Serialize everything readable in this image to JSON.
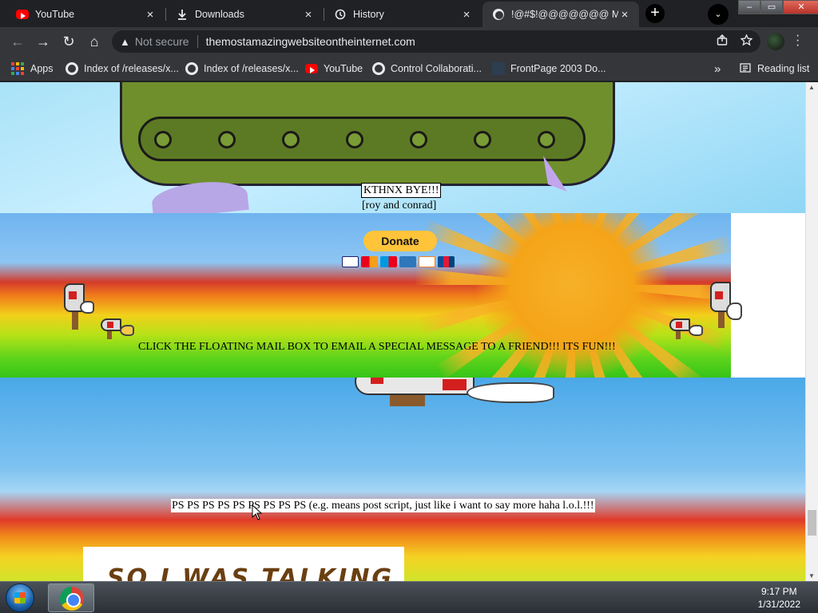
{
  "browser": {
    "tabs": [
      {
        "label": "YouTube",
        "icon": "youtube-icon"
      },
      {
        "label": "Downloads",
        "icon": "download-icon"
      },
      {
        "label": "History",
        "icon": "history-icon"
      },
      {
        "label": "!@#$!@@@@@@@ MY",
        "icon": "globe-icon",
        "active": true
      }
    ],
    "tab_close": "×",
    "new_tab": "+",
    "tab_search": "⌄",
    "window_controls": {
      "minimize": "–",
      "maximize": "▭",
      "close": "✕"
    },
    "nav": {
      "back": "←",
      "forward": "→",
      "reload": "↻",
      "home": "⌂"
    },
    "omnibox": {
      "security_label": "Not secure",
      "url": "themostamazingwebsiteontheinternet.com",
      "warning_glyph": "▲"
    },
    "bookmarks": [
      {
        "label": "Apps",
        "icon": "apps-icon"
      },
      {
        "label": "Index of /releases/x...",
        "icon": "globe-icon"
      },
      {
        "label": "Index of /releases/x...",
        "icon": "globe-icon"
      },
      {
        "label": "YouTube",
        "icon": "youtube-icon"
      },
      {
        "label": "Control Collaborati...",
        "icon": "globe-icon"
      },
      {
        "label": "FrontPage 2003 Do...",
        "icon": "page-icon"
      }
    ],
    "bookmarks_overflow": "»",
    "reading_list": "Reading list"
  },
  "page": {
    "kthnx": "KTHNX BYE!!!",
    "signature": "[roy and conrad]",
    "donate_label": "Donate",
    "mailbox_instruction": "CLICK THE FLOATING MAIL BOX TO EMAIL A SPECIAL MESSAGE TO A FRIEND!!! ITS FUN!!!",
    "ps_line": "PS PS PS PS PS PS PS PS PS (e.g. means post script, just like i want to say more haha l.o.l.!!!",
    "partial_image_text": "SO I WAS TALKING"
  },
  "taskbar": {
    "time": "9:17 PM",
    "date": "1/31/2022"
  },
  "colors": {
    "chrome_dark": "#202124",
    "chrome_toolbar": "#35363a",
    "donate_yellow": "#ffc439",
    "youtube_red": "#ff0000"
  }
}
